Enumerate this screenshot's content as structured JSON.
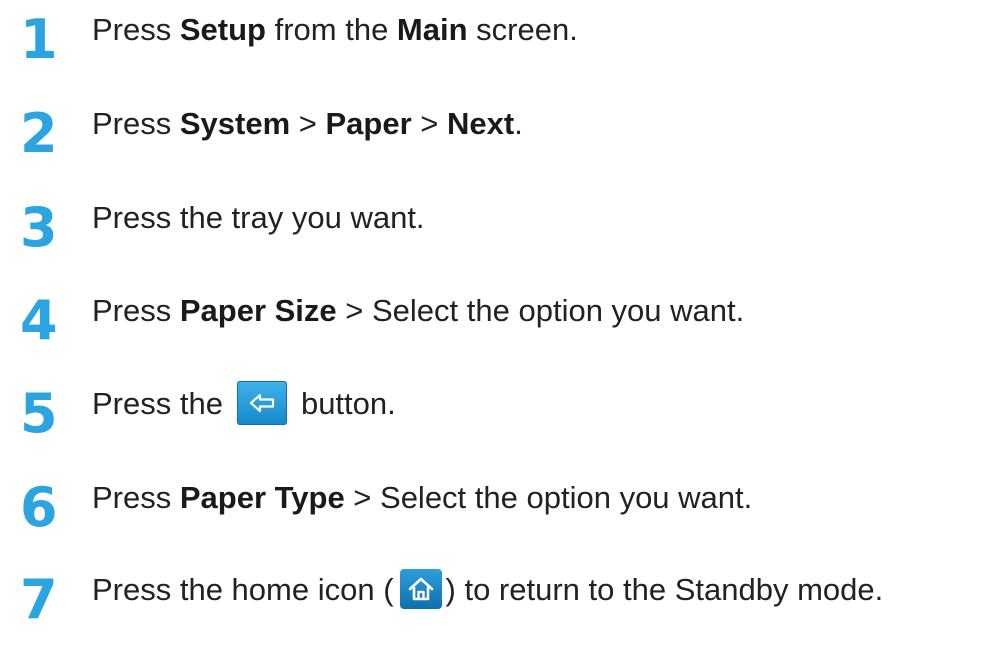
{
  "steps": [
    {
      "number": "1",
      "parts": [
        "Press ",
        "Setup",
        " from the ",
        "Main",
        " screen."
      ]
    },
    {
      "number": "2",
      "parts": [
        "Press ",
        "System",
        " > ",
        "Paper",
        " > ",
        "Next",
        "."
      ]
    },
    {
      "number": "3",
      "parts": [
        "Press the tray you want."
      ]
    },
    {
      "number": "4",
      "parts": [
        "Press ",
        "Paper Size",
        " > Select the option you want."
      ]
    },
    {
      "number": "5",
      "parts": [
        "Press the",
        "button."
      ],
      "icon": "back-arrow-icon"
    },
    {
      "number": "6",
      "parts": [
        "Press ",
        "Paper Type",
        " > Select the option you want."
      ]
    },
    {
      "number": "7",
      "parts": [
        "Press the home icon (",
        ") to return to the Standby mode."
      ],
      "icon": "home-icon"
    }
  ],
  "colors": {
    "step_number": "#2ba4e0",
    "text": "#222222",
    "button_blue": "#1588cc"
  }
}
